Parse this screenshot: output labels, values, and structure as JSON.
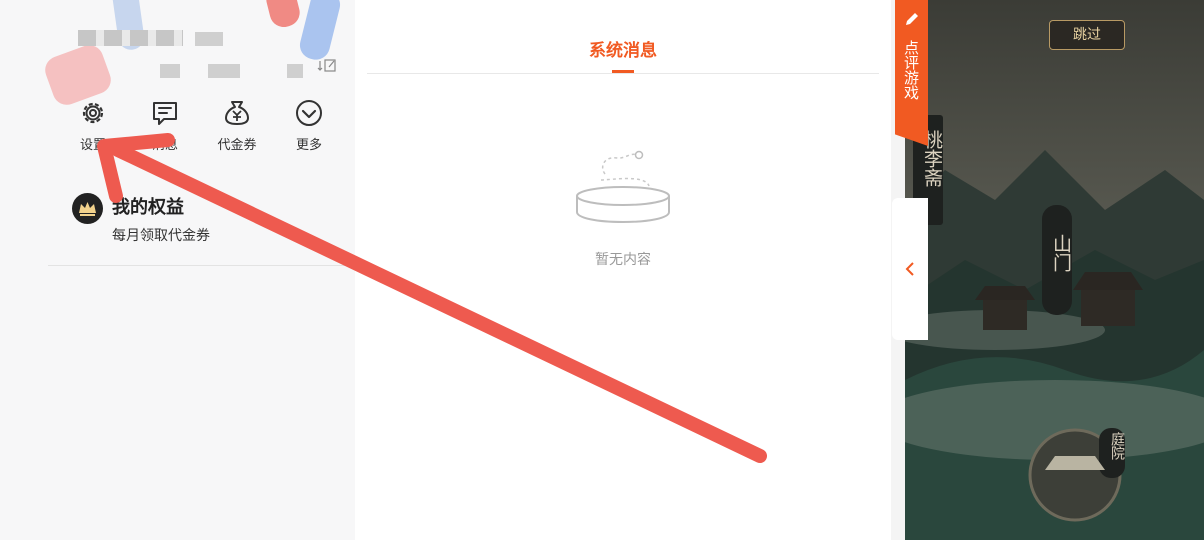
{
  "profile": {
    "quick_actions": [
      {
        "label": "设置",
        "icon": "gear-icon"
      },
      {
        "label": "消息",
        "icon": "message-icon"
      },
      {
        "label": "代金券",
        "icon": "voucher-icon"
      },
      {
        "label": "更多",
        "icon": "more-icon"
      }
    ],
    "rights": {
      "title": "我的权益",
      "subtitle": "每月领取代金券"
    }
  },
  "messages": {
    "tab_label": "系统消息",
    "empty_text": "暂无内容"
  },
  "game_panel": {
    "badge_label": "点评游戏",
    "skip_label": "跳过",
    "scene_labels": [
      "桃李斋",
      "山门",
      "庭院"
    ]
  },
  "colors": {
    "accent": "#f15a22",
    "arrow": "#ee5a4f"
  }
}
